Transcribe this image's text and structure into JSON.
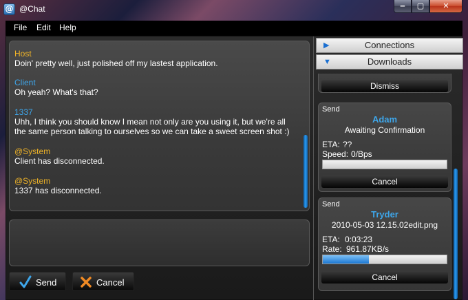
{
  "window": {
    "title": "@Chat",
    "icon": "at-icon",
    "controls": {
      "minimize": "‒",
      "maximize": "▢",
      "close": "✕"
    }
  },
  "menu": {
    "items": [
      "File",
      "Edit",
      "Help"
    ]
  },
  "colors": {
    "host": "#f0b428",
    "client": "#3ea6ea",
    "system": "#f0b428",
    "accent": "#1b77d2"
  },
  "chat": {
    "messages": [
      {
        "sender": "Host",
        "role": "host",
        "text": "Doin' pretty well, just polished off my lastest application."
      },
      {
        "sender": "Client",
        "role": "client",
        "text": "Oh yeah?  What's that?"
      },
      {
        "sender": "1337",
        "role": "client",
        "text": "Uhh, I think you should know I mean not only are you using it, but we're all the same person talking to ourselves so we can take a sweet screen shot :)"
      },
      {
        "sender": "@System",
        "role": "system",
        "text": "Client has disconnected."
      },
      {
        "sender": "@System",
        "role": "system",
        "text": "1337 has disconnected."
      }
    ],
    "input_value": "",
    "send_label": "Send",
    "cancel_label": "Cancel"
  },
  "sidebar": {
    "connections_label": "Connections",
    "downloads_label": "Downloads",
    "downloads": [
      {
        "button": "Dismiss"
      },
      {
        "kind": "Send",
        "name": "Adam",
        "status": "Awaiting Confirmation",
        "eta_label": "ETA:",
        "eta": "??",
        "speed_label": "Speed:",
        "speed": "0/Bps",
        "progress": 0,
        "cancel": "Cancel"
      },
      {
        "kind": "Send",
        "name": "Tryder",
        "file": "2010-05-03 12.15.02edit.png",
        "eta_label": "ETA:",
        "eta": "0:03:23",
        "rate_label": "Rate:",
        "rate": "961.87KB/s",
        "progress": 0.37,
        "cancel": "Cancel"
      }
    ]
  }
}
